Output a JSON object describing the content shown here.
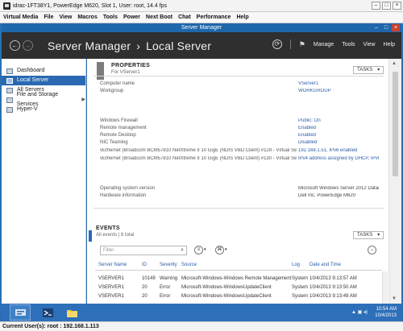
{
  "viewer": {
    "title": "idrac-1FT38Y1, PowerEdge M620, Slot 1, User: root, 14.4 fps",
    "menu": [
      "Virtual Media",
      "File",
      "View",
      "Macros",
      "Tools",
      "Power",
      "Next Boot",
      "Chat",
      "Performance",
      "Help"
    ],
    "status": "Current User(s): root : 192.168.1.113"
  },
  "server_manager": {
    "window_title": "Server Manager",
    "breadcrumb": [
      "Server Manager",
      "Local Server"
    ],
    "header_menu": [
      "Manage",
      "Tools",
      "View",
      "Help"
    ],
    "nav": [
      {
        "label": "Dashboard"
      },
      {
        "label": "Local Server"
      },
      {
        "label": "All Servers"
      },
      {
        "label": "File and Storage Services"
      },
      {
        "label": "Hyper-V"
      }
    ],
    "properties": {
      "title": "PROPERTIES",
      "subtitle": "For VServer1",
      "tasks": "TASKS",
      "rows": [
        {
          "label": "Computer name",
          "value": "VServer1"
        },
        {
          "label": "Workgroup",
          "value": "WORKGROUP"
        },
        {
          "label": "Windows Firewall",
          "value": "Public: On"
        },
        {
          "label": "Remote management",
          "value": "Enabled"
        },
        {
          "label": "Remote Desktop",
          "value": "Enabled"
        },
        {
          "label": "NIC Teaming",
          "value": "Disabled"
        },
        {
          "label": "vEthernet (Broadcom BCM57810 NetXtreme II 10 GigE (NDIS VBD Client) #129 - Virtual Switch)",
          "value": "192.168.1.51, IPv6 enabled"
        },
        {
          "label": "vEthernet (Broadcom BCM57810 NetXtreme II 10 GigE (NDIS VBD Client) #130 - Virtual Switch)",
          "value": "IPv4 address assigned by DHCP, IPv6 enabled"
        },
        {
          "label": "Operating system version",
          "value": "Microsoft Windows Server 2012 Datacenter"
        },
        {
          "label": "Hardware information",
          "value": "Dell Inc. PowerEdge M620"
        }
      ]
    },
    "events": {
      "title": "EVENTS",
      "subtitle": "All events | 8 total",
      "tasks": "TASKS",
      "filter_placeholder": "Filter",
      "columns": [
        "Server Name",
        "ID",
        "Severity",
        "Source",
        "Log",
        "Date and Time"
      ],
      "rows": [
        [
          "VSERVER1",
          "10149",
          "Warning",
          "Microsoft-Windows-Windows Remote Management",
          "System",
          "10/4/2013 9:13:57 AM"
        ],
        [
          "VSERVER1",
          "20",
          "Error",
          "Microsoft-Windows-WindowsUpdateClient",
          "System",
          "10/4/2013 9:13:50 AM"
        ],
        [
          "VSERVER1",
          "20",
          "Error",
          "Microsoft-Windows-WindowsUpdateClient",
          "System",
          "10/4/2013 9:13:49 AM"
        ]
      ]
    }
  },
  "taskbar": {
    "time": "10:54 AM",
    "date": "10/4/2013"
  },
  "colors": {
    "accent": "#2a69b2",
    "header_dark": "#2f2f2f",
    "taskbar": "#2d6fb8"
  }
}
